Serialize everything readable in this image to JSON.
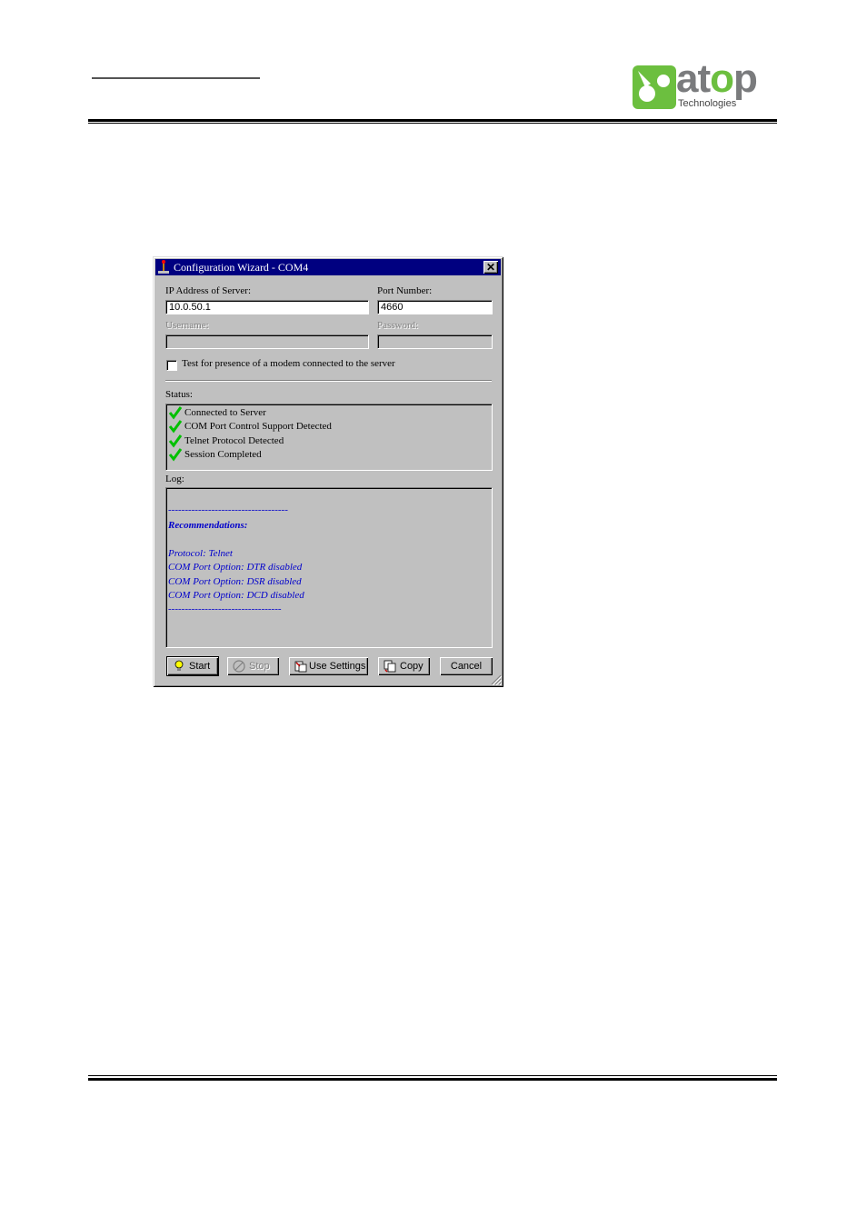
{
  "page": {
    "logo": {
      "word_before": "at",
      "word_o": "o",
      "word_after": "p",
      "tagline": "Technologies"
    }
  },
  "dialog": {
    "title": "Configuration Wizard - COM4",
    "close_label": "✕",
    "ip_label": "IP Address of Server:",
    "ip_value": "10.0.50.1",
    "port_label": "Port Number:",
    "port_value": "4660",
    "username_label": "Username:",
    "password_label": "Password:",
    "modem_check_label": "Test for presence of a modem connected to the server",
    "status_label": "Status:",
    "status_items": [
      "Connected to Server",
      "COM Port Control Support Detected",
      "Telnet Protocol Detected",
      "Session Completed"
    ],
    "log_label": "Log:",
    "log_lines": [
      "------------------------------------",
      "Recommendations:",
      "",
      "Protocol: Telnet",
      "COM Port Option: DTR disabled",
      "COM Port Option: DSR disabled",
      "COM Port Option: DCD disabled",
      "----------------------------------"
    ],
    "buttons": {
      "start": "Start",
      "stop": "Stop",
      "use_settings": "Use Settings",
      "copy": "Copy",
      "cancel": "Cancel"
    },
    "icons": {
      "app": "wizard-icon",
      "status_check": "green-checkmark-icon",
      "start": "lightbulb-icon",
      "stop": "stop-icon",
      "use_settings": "settings-icon",
      "copy": "copy-icon"
    },
    "colors": {
      "titlebar": "#000080",
      "log_text": "#0000cc",
      "check": "#00c000"
    }
  }
}
